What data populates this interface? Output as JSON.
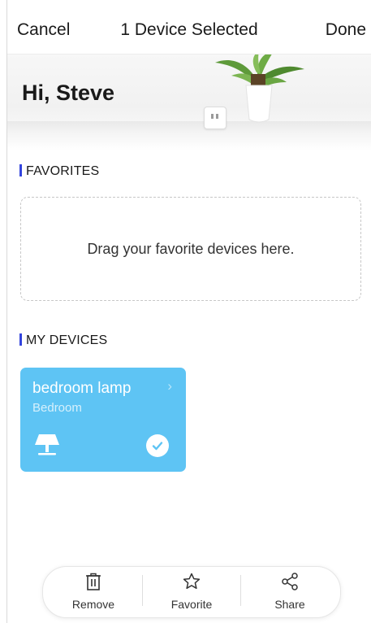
{
  "topbar": {
    "cancel_label": "Cancel",
    "title": "1 Device Selected",
    "done_label": "Done"
  },
  "hero": {
    "greeting": "Hi, Steve"
  },
  "favorites": {
    "heading": "FAVORITES",
    "empty_hint": "Drag your favorite devices here."
  },
  "my_devices": {
    "heading": "MY DEVICES",
    "devices": [
      {
        "name": "bedroom lamp",
        "room": "Bedroom",
        "icon": "lamp-icon",
        "selected": true,
        "card_color": "#5ec4f4"
      }
    ]
  },
  "actions": [
    {
      "label": "Remove",
      "icon": "trash-icon"
    },
    {
      "label": "Favorite",
      "icon": "star-icon"
    },
    {
      "label": "Share",
      "icon": "share-icon"
    }
  ],
  "colors": {
    "accent_bar": "#3344dd",
    "card": "#5ec4f4"
  }
}
